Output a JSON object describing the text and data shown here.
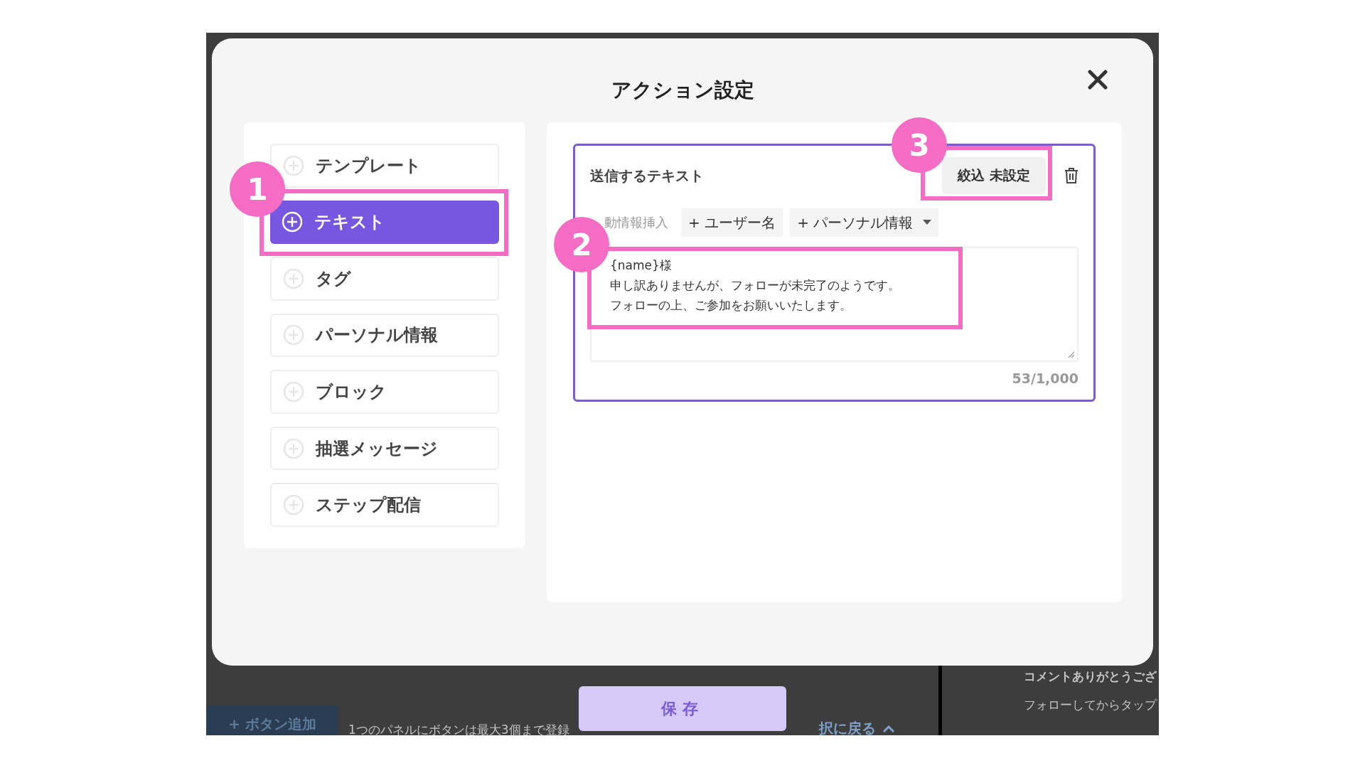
{
  "background": {
    "add_button": "+ ボタン追加",
    "note": "1つのパネルにボタンは最大3個まで登録",
    "back_link": "択に戻る",
    "side_lines": [
      "コメントありがとうござ",
      "フォローしてからタップ"
    ]
  },
  "modal": {
    "title": "アクション設定",
    "menu": [
      {
        "label": "テンプレート",
        "selected": false
      },
      {
        "label": "テキスト",
        "selected": true
      },
      {
        "label": "タグ",
        "selected": false
      },
      {
        "label": "パーソナル情報",
        "selected": false
      },
      {
        "label": "ブロック",
        "selected": false
      },
      {
        "label": "抽選メッセージ",
        "selected": false
      },
      {
        "label": "ステップ配信",
        "selected": false
      }
    ],
    "card": {
      "title": "送信するテキスト",
      "filter_button": "絞込 未設定",
      "insert_label": "動情報挿入",
      "insert_buttons": [
        {
          "label": "+ ユーザー名",
          "kind": "button"
        },
        {
          "label": "+ パーソナル情報",
          "kind": "dropdown"
        }
      ],
      "message_lines": [
        "{name}様",
        "申し訳ありませんが、フォローが未完了のようです。",
        "フォローの上、ご参加をお願いいたします。"
      ],
      "counter": "53/1,000"
    }
  },
  "save_button": "保存",
  "annotations": [
    {
      "label": "1"
    },
    {
      "label": "2"
    },
    {
      "label": "3"
    }
  ]
}
